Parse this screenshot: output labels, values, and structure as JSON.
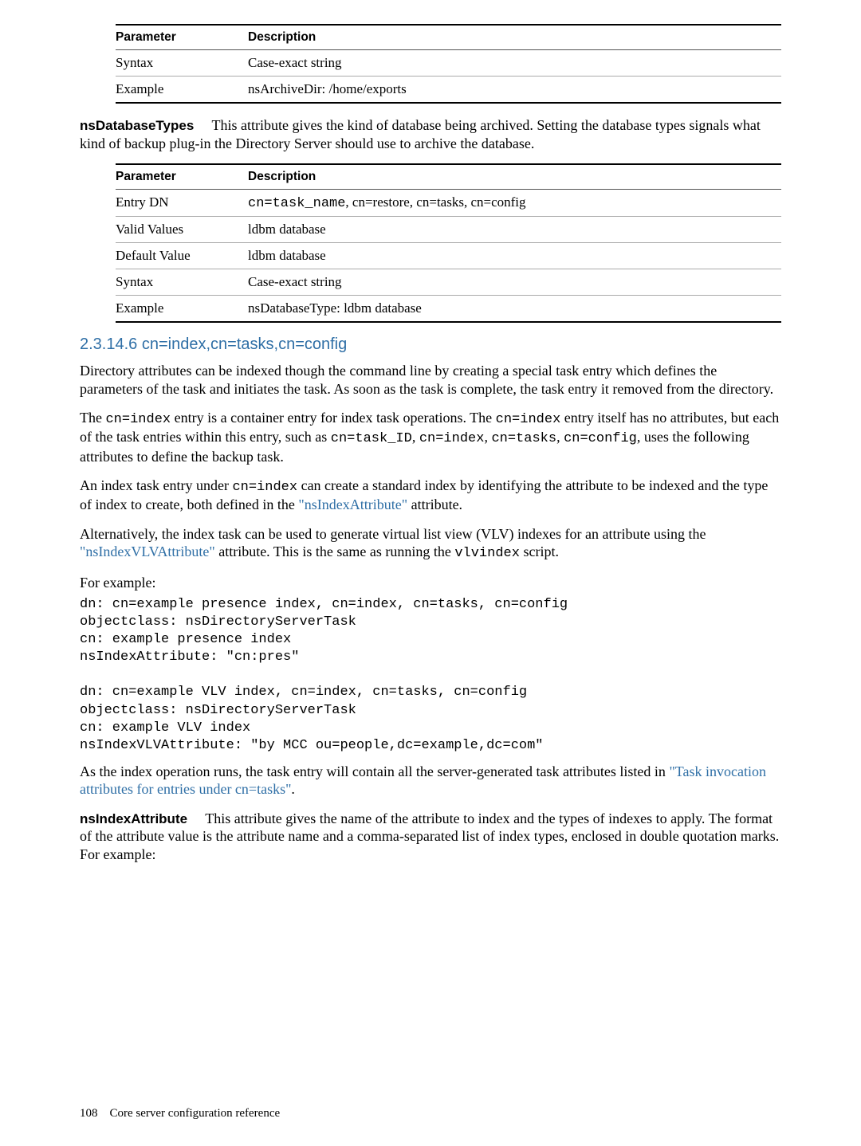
{
  "table1": {
    "header": {
      "param": "Parameter",
      "desc": "Description"
    },
    "rows": [
      {
        "param": "Syntax",
        "desc": "Case-exact string"
      },
      {
        "param": "Example",
        "desc": "nsArchiveDir: /home/exports"
      }
    ]
  },
  "nsDatabaseTypes": {
    "title": "nsDatabaseTypes",
    "text": "This attribute gives the kind of database being archived. Setting the database types signals what kind of backup plug-in the Directory Server should use to archive the database."
  },
  "table2": {
    "header": {
      "param": "Parameter",
      "desc": "Description"
    },
    "rows": [
      {
        "param": "Entry DN",
        "desc_pre": "cn=task_name",
        "desc_post": ", cn=restore, cn=tasks, cn=config"
      },
      {
        "param": "Valid Values",
        "desc": "ldbm database"
      },
      {
        "param": "Default Value",
        "desc": "ldbm database"
      },
      {
        "param": "Syntax",
        "desc": "Case-exact string"
      },
      {
        "param": "Example",
        "desc": "nsDatabaseType: ldbm database"
      }
    ]
  },
  "section": {
    "number": "2.3.14.6",
    "title": "cn=index,cn=tasks,cn=config"
  },
  "body": {
    "p1": "Directory attributes can be indexed though the command line by creating a special task entry which defines the parameters of the task and initiates the task. As soon as the task is complete, the task entry it removed from the directory.",
    "p2_pre": "The ",
    "p2_code1": "cn=index",
    "p2_mid1": " entry is a container entry for index task operations. The ",
    "p2_code2": "cn=index",
    "p2_mid2": " entry itself has no attributes, but each of the task entries within this entry, such as ",
    "p2_code3": "cn=task_ID",
    "p2_mid3": ", ",
    "p2_code4": "cn=index",
    "p2_mid4": ", ",
    "p2_code5": "cn=tasks",
    "p2_mid5": ", ",
    "p2_code6": "cn=config",
    "p2_post": ", uses the following attributes to define the backup task.",
    "p3_pre": "An index task entry under ",
    "p3_code": "cn=index",
    "p3_mid": " can create a standard index by identifying the attribute to be indexed and the type of index to create, both defined in the ",
    "p3_link": "\"nsIndexAttribute\"",
    "p3_post": " attribute.",
    "p4_pre": "Alternatively, the index task can be used to generate virtual list view (VLV) indexes for an attribute using the ",
    "p4_link": "\"nsIndexVLVAttribute\"",
    "p4_mid": " attribute. This is the same as running the ",
    "p4_code": "vlvindex",
    "p4_post": " script.",
    "forexample": "For example:",
    "code": "dn: cn=example presence index, cn=index, cn=tasks, cn=config\nobjectclass: nsDirectoryServerTask\ncn: example presence index\nnsIndexAttribute: \"cn:pres\"\n\ndn: cn=example VLV index, cn=index, cn=tasks, cn=config\nobjectclass: nsDirectoryServerTask\ncn: example VLV index\nnsIndexVLVAttribute: \"by MCC ou=people,dc=example,dc=com\"",
    "p5_pre": "As the index operation runs, the task entry will contain all the server-generated task attributes listed in ",
    "p5_link": "\"Task invocation attributes for entries under cn=tasks\"",
    "p5_post": ".",
    "nsIndexAttr_title": "nsIndexAttribute",
    "nsIndexAttr_text": "This attribute gives the name of the attribute to index and the types of indexes to apply. The format of the attribute value is the attribute name and a comma-separated list of index types, enclosed in double quotation marks. For example:"
  },
  "footer": {
    "page": "108",
    "title": "Core server configuration reference"
  }
}
